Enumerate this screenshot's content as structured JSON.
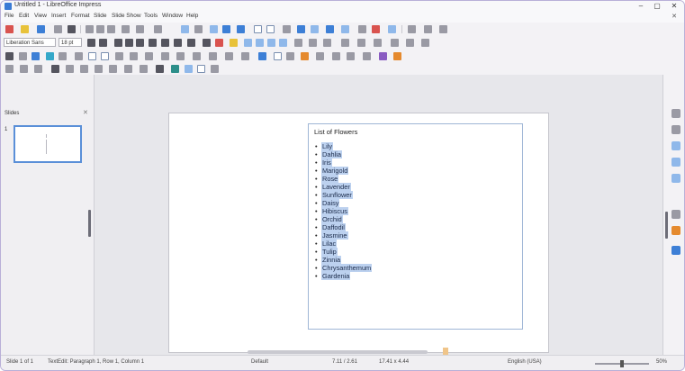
{
  "window": {
    "title": "Untitled 1 - LibreOffice Impress",
    "controls": [
      "–",
      "▢",
      "✕"
    ]
  },
  "menu": {
    "items": [
      "File",
      "Edit",
      "View",
      "Insert",
      "Format",
      "Slide",
      "Slide Show",
      "Tools",
      "Window",
      "Help"
    ],
    "close_glyph": "✕"
  },
  "toolbar": {
    "font_name": "Liberation Sans",
    "font_size": "18 pt"
  },
  "slides_pane": {
    "title": "Slides",
    "close_glyph": "✕",
    "thumbnail_number": "1"
  },
  "slide": {
    "title": "List of Flowers",
    "bullet": "•",
    "flowers": [
      "Lily",
      "Dahlia",
      "Iris",
      "Marigold",
      "Rose",
      "Lavender",
      "Sunflower",
      "Daisy",
      "Hibiscus",
      "Orchid",
      "Daffodil",
      "Jasmine",
      "Lilac",
      "Tulip",
      "Zinnia",
      "Chrysanthemum",
      "Gardenia"
    ]
  },
  "statusbar": {
    "slide_info": "Slide 1 of 1",
    "selection": "TextEdit: Paragraph 1, Row 1, Column 1",
    "master": "Default",
    "position": "7.11 / 2.61",
    "size": "17.41 x 4.44",
    "language": "English (USA)",
    "zoom": "50%"
  },
  "colors": {
    "selection_highlight": "#bcd1ef",
    "accent": "#5a8fd8"
  }
}
